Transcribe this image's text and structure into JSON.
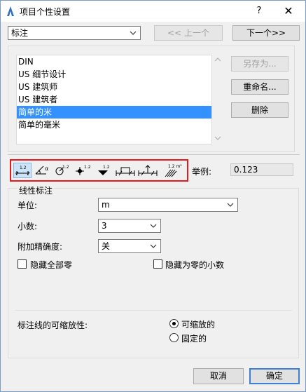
{
  "window": {
    "title": "项目个性设置",
    "help_label": "?",
    "close_label": "✕"
  },
  "header": {
    "category_select": "标注",
    "prev_label": "<< 上一个",
    "next_label": "下一个>>"
  },
  "presets": {
    "items": [
      "DIN",
      "US 细节设计",
      "US 建筑师",
      "US 建筑者",
      "简单的米",
      "简单的毫米"
    ],
    "selected_index": 4,
    "save_as_label": "另存为...",
    "rename_label": "重命名...",
    "delete_label": "删除"
  },
  "toolbar": {
    "tools": [
      {
        "name": "linear-dimension-tool-icon",
        "active": true
      },
      {
        "name": "angle-dimension-tool-icon",
        "active": false
      },
      {
        "name": "radial-dimension-tool-icon",
        "active": false
      },
      {
        "name": "level-dimension-tool-icon",
        "active": false
      },
      {
        "name": "elevation-dimension-tool-icon",
        "active": false
      },
      {
        "name": "door-window-dimension-tool-icon",
        "active": false
      },
      {
        "name": "sill-height-tool-icon",
        "active": false
      },
      {
        "name": "area-calculation-tool-icon",
        "active": false
      }
    ],
    "tool_labels": {
      "linear": "1.2",
      "angle": "α",
      "radial": "1.2",
      "level": "1.2",
      "elevation": "1.2",
      "area": "1.2 m²"
    },
    "example_label": "举例:",
    "example_value": "0.123",
    "accent_color": "#e8181c"
  },
  "linear": {
    "group_title": "线性标注",
    "unit_label": "单位:",
    "unit_value": "m",
    "decimals_label": "小数:",
    "decimals_value": "3",
    "extra_accuracy_label": "附加精确度:",
    "extra_accuracy_value": "关",
    "hide_all_zeros_label": "隐藏全部零",
    "hide_all_zeros_checked": false,
    "hide_zero_decimals_label": "隐藏为零的小数",
    "hide_zero_decimals_checked": false,
    "scalability_label": "标注线的可缩放性:",
    "scalable_label": "可缩放的",
    "fixed_label": "固定的",
    "scalable_selected": true
  },
  "footer": {
    "cancel_label": "取消",
    "ok_label": "确定"
  }
}
